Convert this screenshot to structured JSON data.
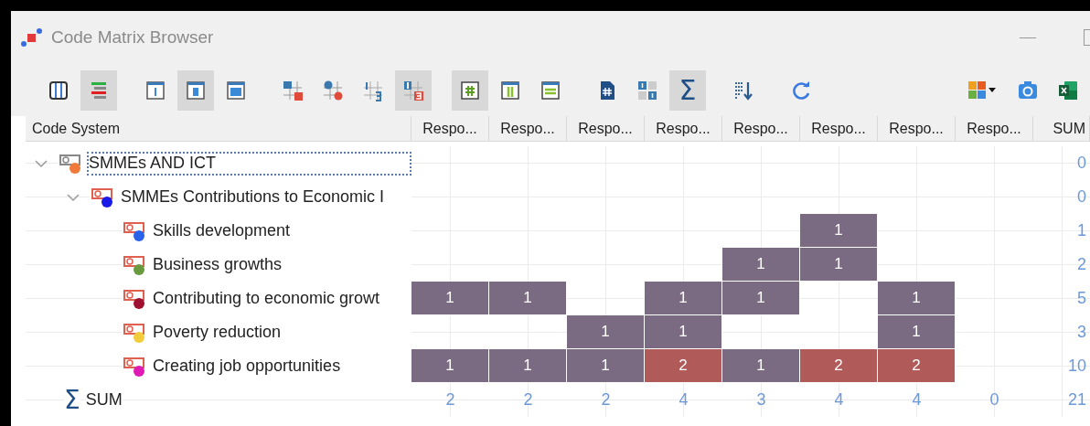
{
  "window": {
    "title": "Code Matrix Browser"
  },
  "toolbar": {
    "groups": [
      [
        {
          "kind": "columns",
          "pressed": false
        },
        {
          "kind": "hierarchy",
          "pressed": true
        }
      ],
      [
        {
          "kind": "frame_narrow",
          "pressed": false
        },
        {
          "kind": "frame_medium",
          "pressed": true
        },
        {
          "kind": "frame_full",
          "pressed": false
        }
      ],
      [
        {
          "kind": "squares",
          "pressed": false
        },
        {
          "kind": "circles",
          "pressed": false
        },
        {
          "kind": "numbers",
          "pressed": false
        },
        {
          "kind": "numbers_colored",
          "pressed": true
        }
      ],
      [
        {
          "kind": "hash",
          "pressed": true
        },
        {
          "kind": "bars",
          "pressed": false
        },
        {
          "kind": "lines",
          "pressed": false
        }
      ],
      [
        {
          "kind": "doc_hash",
          "pressed": false
        },
        {
          "kind": "grid_ones",
          "pressed": false
        },
        {
          "kind": "sigma",
          "pressed": true,
          "glyph": "Σ"
        }
      ],
      [
        {
          "kind": "sort",
          "pressed": false
        }
      ],
      [
        {
          "kind": "refresh",
          "pressed": false
        }
      ]
    ],
    "right": [
      {
        "kind": "puzzle",
        "pressed": false
      },
      {
        "kind": "camera",
        "pressed": false
      },
      {
        "kind": "excel",
        "pressed": false
      }
    ]
  },
  "matrix": {
    "corner_header": "Code System",
    "columns": [
      "Respo...",
      "Respo...",
      "Respo...",
      "Respo...",
      "Respo...",
      "Respo...",
      "Respo...",
      "Respo..."
    ],
    "sum_header": "SUM",
    "codes": [
      {
        "name": "SMMEs AND ICT",
        "kind": "code_set",
        "color": "#f07a3a",
        "expanded": true,
        "selected": true,
        "sum": "0",
        "cells": [
          null,
          null,
          null,
          null,
          null,
          null,
          null,
          null
        ],
        "children": [
          {
            "name": "SMMEs Contributions to Economic I",
            "kind": "code",
            "color": "#1a1ae8",
            "expanded": true,
            "selected": false,
            "sum": "0",
            "cells": [
              null,
              null,
              null,
              null,
              null,
              null,
              null,
              null
            ],
            "children": [
              {
                "name": "Skills development",
                "kind": "code",
                "color": "#2a62e8",
                "selected": false,
                "sum": "1",
                "cells": [
                  null,
                  null,
                  null,
                  null,
                  null,
                  {
                    "value": "1",
                    "color": "#7a6a82"
                  },
                  null,
                  null
                ]
              },
              {
                "name": "Business growths",
                "kind": "code",
                "color": "#6a9a40",
                "selected": false,
                "sum": "2",
                "cells": [
                  null,
                  null,
                  null,
                  null,
                  {
                    "value": "1",
                    "color": "#7a6a82"
                  },
                  {
                    "value": "1",
                    "color": "#7a6a82"
                  },
                  null,
                  null
                ]
              },
              {
                "name": "Contributing to economic growt",
                "kind": "code",
                "color": "#a01030",
                "selected": false,
                "sum": "5",
                "cells": [
                  {
                    "value": "1",
                    "color": "#7a6a82"
                  },
                  {
                    "value": "1",
                    "color": "#7a6a82"
                  },
                  null,
                  {
                    "value": "1",
                    "color": "#7a6a82"
                  },
                  {
                    "value": "1",
                    "color": "#7a6a82"
                  },
                  null,
                  {
                    "value": "1",
                    "color": "#7a6a82"
                  },
                  null
                ]
              },
              {
                "name": "Poverty reduction",
                "kind": "code",
                "color": "#f2cc3a",
                "selected": false,
                "sum": "3",
                "cells": [
                  null,
                  null,
                  {
                    "value": "1",
                    "color": "#7a6a82"
                  },
                  {
                    "value": "1",
                    "color": "#7a6a82"
                  },
                  null,
                  null,
                  {
                    "value": "1",
                    "color": "#7a6a82"
                  },
                  null
                ]
              },
              {
                "name": "Creating job opportunities",
                "kind": "code",
                "color": "#e01ab4",
                "selected": false,
                "sum": "10",
                "cells": [
                  {
                    "value": "1",
                    "color": "#7a6a82"
                  },
                  {
                    "value": "1",
                    "color": "#7a6a82"
                  },
                  {
                    "value": "1",
                    "color": "#7a6a82"
                  },
                  {
                    "value": "2",
                    "color": "#b05a5a"
                  },
                  {
                    "value": "1",
                    "color": "#7a6a82"
                  },
                  {
                    "value": "2",
                    "color": "#b05a5a"
                  },
                  {
                    "value": "2",
                    "color": "#b05a5a"
                  },
                  null
                ]
              }
            ]
          }
        ]
      }
    ],
    "sum_row": {
      "icon": "Σ",
      "label": "SUM",
      "values": [
        "2",
        "2",
        "2",
        "4",
        "3",
        "4",
        "4",
        "0"
      ],
      "total": "21"
    }
  }
}
